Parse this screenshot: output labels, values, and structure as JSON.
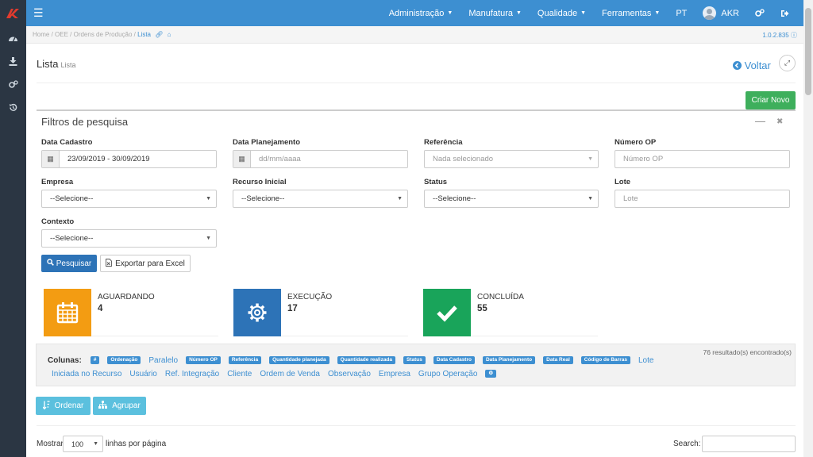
{
  "topbar": {
    "menus": [
      {
        "label": "Administração"
      },
      {
        "label": "Manufatura"
      },
      {
        "label": "Qualidade"
      },
      {
        "label": "Ferramentas"
      }
    ],
    "lang": "PT",
    "user": "AKR",
    "accent": "#3d8fd1"
  },
  "sidebar": {
    "items": [
      {
        "icon": "dashboard-icon"
      },
      {
        "icon": "download-icon"
      },
      {
        "icon": "cogs-icon"
      },
      {
        "icon": "history-icon"
      }
    ]
  },
  "breadcrumb": {
    "home": "Home",
    "oee": "OEE",
    "ordens": "Ordens de Produção",
    "current": "Lista",
    "version": "1.0.2.835"
  },
  "page": {
    "title": "Lista",
    "subtitle": "Lista",
    "back_label": "Voltar"
  },
  "buttons": {
    "criar": "Criar Novo",
    "pesquisar": "Pesquisar",
    "exportar": "Exportar para Excel",
    "ordenar": "Ordenar",
    "agrupar": "Agrupar"
  },
  "filters": {
    "title": "Filtros de pesquisa",
    "data_cadastro": {
      "label": "Data Cadastro",
      "value": "23/09/2019 - 30/09/2019"
    },
    "data_planejamento": {
      "label": "Data Planejamento",
      "placeholder": "dd/mm/aaaa"
    },
    "referencia": {
      "label": "Referência",
      "placeholder": "Nada selecionado"
    },
    "numero_op": {
      "label": "Número OP",
      "placeholder": "Número OP"
    },
    "empresa": {
      "label": "Empresa",
      "value": "--Selecione--"
    },
    "recurso": {
      "label": "Recurso Inicial",
      "value": "--Selecione--"
    },
    "status": {
      "label": "Status",
      "value": "--Selecione--"
    },
    "lote": {
      "label": "Lote",
      "placeholder": "Lote"
    },
    "contexto": {
      "label": "Contexto",
      "value": "--Selecione--"
    }
  },
  "cards": [
    {
      "title": "AGUARDANDO",
      "count": "4",
      "color": "#f39c12",
      "icon": "calendar-icon"
    },
    {
      "title": "EXECUÇÃO",
      "count": "17",
      "color": "#2d73b7",
      "icon": "gear-icon"
    },
    {
      "title": "CONCLUÍDA",
      "count": "55",
      "color": "#19a45a",
      "icon": "check-icon"
    }
  ],
  "columns": {
    "label": "Colunas:",
    "results": "76 resultado(s) encontrado(s)",
    "items": [
      {
        "text": "#",
        "active": true
      },
      {
        "text": "Ordenação",
        "active": true
      },
      {
        "text": "Paralelo",
        "active": false
      },
      {
        "text": "Número OP",
        "active": true
      },
      {
        "text": "Referência",
        "active": true
      },
      {
        "text": "Quantidade planejada",
        "active": true
      },
      {
        "text": "Quantidade realizada",
        "active": true
      },
      {
        "text": "Status",
        "active": true
      },
      {
        "text": "Data Cadastro",
        "active": true
      },
      {
        "text": "Data Planejamento",
        "active": true
      },
      {
        "text": "Data Real",
        "active": true
      },
      {
        "text": "Código de Barras",
        "active": true
      },
      {
        "text": "Lote",
        "active": false
      },
      {
        "text": "Iniciada no Recurso",
        "active": false
      },
      {
        "text": "Usuário",
        "active": false
      },
      {
        "text": "Ref. Integração",
        "active": false
      },
      {
        "text": "Cliente",
        "active": false
      },
      {
        "text": "Ordem de Venda",
        "active": false
      },
      {
        "text": "Observação",
        "active": false
      },
      {
        "text": "Empresa",
        "active": false
      },
      {
        "text": "Grupo Operação",
        "active": false
      }
    ]
  },
  "table": {
    "show_label": "Mostrar",
    "page_size": "100",
    "per_page_label": "linhas por página",
    "search_label": "Search:"
  }
}
